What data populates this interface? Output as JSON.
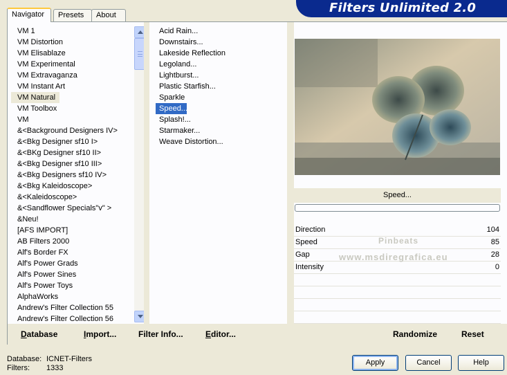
{
  "tabs": [
    {
      "label": "Navigator",
      "active": true
    },
    {
      "label": "Presets",
      "active": false
    },
    {
      "label": "About",
      "active": false
    }
  ],
  "banner": {
    "title": "Filters Unlimited 2.0"
  },
  "categories": [
    "VM 1",
    "VM Distortion",
    "VM Elisablaze",
    "VM Experimental",
    "VM Extravaganza",
    "VM Instant Art",
    "VM Natural",
    "VM Toolbox",
    "VM",
    "&<Background Designers IV>",
    "&<Bkg Designer sf10 I>",
    "&<BKg Designer sf10 II>",
    "&<Bkg Designer sf10 III>",
    "&<Bkg Designers sf10 IV>",
    "&<Bkg Kaleidoscope>",
    "&<Kaleidoscope>",
    "&<Sandflower Specials\"v\" >",
    "&Neu!",
    "[AFS IMPORT]",
    "AB Filters 2000",
    "Alf's Border FX",
    "Alf's Power Grads",
    "Alf's Power Sines",
    "Alf's Power Toys",
    "AlphaWorks",
    "Andrew's Filter Collection 55",
    "Andrew's Filter Collection 56"
  ],
  "selected_category": "VM Natural",
  "filters": [
    "Acid Rain...",
    "Downstairs...",
    "Lakeside Reflection",
    "Legoland...",
    "Lightburst...",
    "Plastic Starfish...",
    "Sparkle",
    "Speed...",
    "Splash!...",
    "Starmaker...",
    "Weave Distortion..."
  ],
  "selected_filter": "Speed...",
  "preview": {
    "filter_name": "Speed...",
    "progress": 0
  },
  "params": [
    {
      "label": "Direction",
      "value": "104"
    },
    {
      "label": "Speed",
      "value": "85"
    },
    {
      "label": "Gap",
      "value": "28"
    },
    {
      "label": "Intensity",
      "value": "0"
    }
  ],
  "panel_buttons": {
    "database": {
      "ul": "D",
      "rest": "atabase"
    },
    "import": {
      "ul": "I",
      "rest": "mport..."
    },
    "filter_info": {
      "ul": "",
      "rest": "Filter Info..."
    },
    "editor": {
      "ul": "E",
      "rest": "ditor..."
    },
    "randomize": "Randomize",
    "reset": "Reset"
  },
  "watermark": {
    "line1": "Pinbeats",
    "line2": "www.msdiregrafica.eu"
  },
  "status": {
    "database_label": "Database:",
    "database_value": "ICNET-Filters",
    "filters_label": "Filters:",
    "filters_value": "1333"
  },
  "dialog_buttons": {
    "apply": "Apply",
    "cancel": "Cancel",
    "help": "Help"
  },
  "colors": {
    "banner": "#0a2a8e",
    "selection": "#316ac5",
    "panel_bg": "#ece9d8"
  }
}
